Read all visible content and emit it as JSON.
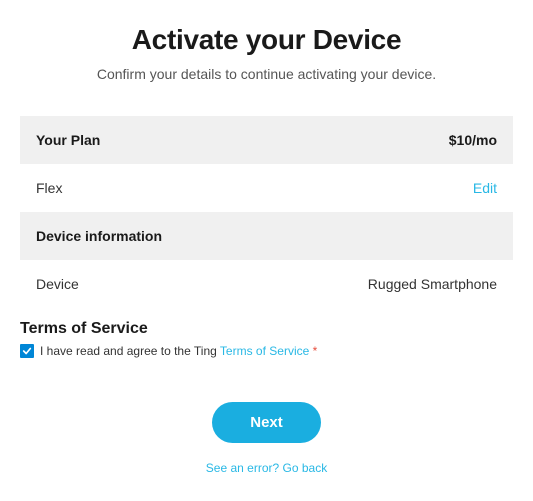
{
  "header": {
    "title": "Activate your Device",
    "subtitle": "Confirm your details to continue activating your device."
  },
  "plan": {
    "section_label": "Your Plan",
    "price": "$10/mo",
    "name": "Flex",
    "edit_label": "Edit"
  },
  "device": {
    "section_label": "Device information",
    "row_label": "Device",
    "row_value": "Rugged Smartphone"
  },
  "tos": {
    "heading": "Terms of Service",
    "agree_prefix": "I have read and agree to the Ting ",
    "link_text": "Terms of Service",
    "required_mark": " *"
  },
  "actions": {
    "next_label": "Next",
    "back_label": "See an error? Go back"
  }
}
